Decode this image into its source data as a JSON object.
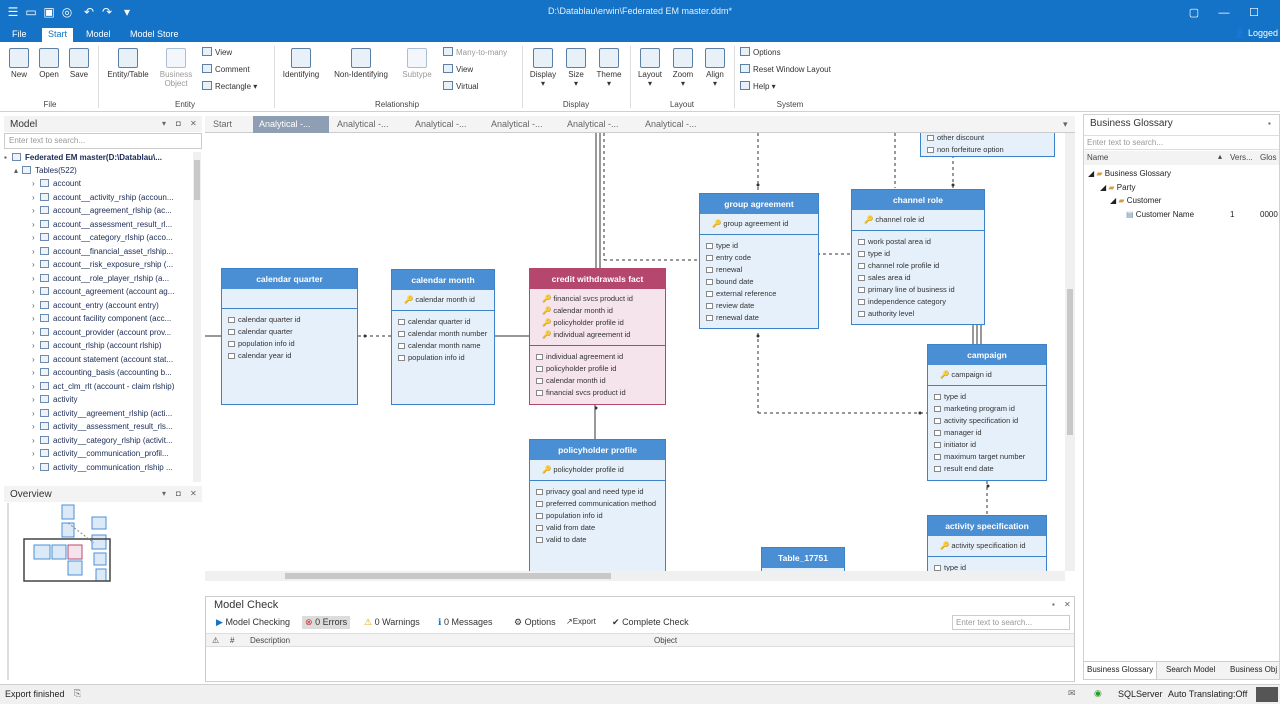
{
  "window": {
    "title": "D:\\Datablau\\erwin\\Federated EM master.ddm*"
  },
  "menu": {
    "items": [
      "File",
      "Start",
      "Model",
      "Model Store"
    ],
    "user": "Logged"
  },
  "ribbon": {
    "large": [
      {
        "label": "New",
        "icon": "new-icon"
      },
      {
        "label": "Open",
        "icon": "open-icon"
      },
      {
        "label": "Save",
        "icon": "save-icon"
      },
      {
        "label": "Entity/Table",
        "icon": "entity-icon"
      },
      {
        "label": "Business\nObject",
        "icon": "business-object-icon"
      },
      {
        "label": "Identifying",
        "icon": "identifying-icon"
      },
      {
        "label": "Non-Identifying",
        "icon": "non-identifying-icon"
      },
      {
        "label": "Subtype",
        "icon": "subtype-icon"
      },
      {
        "label": "Display",
        "icon": "display-icon"
      },
      {
        "label": "Size",
        "icon": "size-icon"
      },
      {
        "label": "Theme",
        "icon": "theme-icon"
      },
      {
        "label": "Layout",
        "icon": "layout-icon"
      },
      {
        "label": "Zoom",
        "icon": "zoom-icon"
      },
      {
        "label": "Align",
        "icon": "align-icon"
      }
    ],
    "small": {
      "view": "View",
      "comment": "Comment",
      "rectangle": "Rectangle",
      "many": "Many-to-many",
      "rview": "View",
      "virtual": "Virtual",
      "options": "Options",
      "reset": "Reset Window Layout",
      "help": "Help"
    },
    "groups": [
      "File",
      "Entity",
      "Relationship",
      "Display",
      "Layout",
      "System"
    ]
  },
  "model": {
    "title": "Model",
    "search_placeholder": "Enter text to search...",
    "root": "Federated EM master(D:\\Datablau\\...",
    "tables": "Tables(522)",
    "items": [
      "account",
      "account__activity_rship (accoun...",
      "account__agreement_rlship (ac...",
      "account__assessment_result_rl...",
      "account__category_rlship (acco...",
      "account__financial_asset_rlship...",
      "account__risk_exposure_rship (...",
      "account__role_player_rlship (a...",
      "account_agreement (account ag...",
      "account_entry (account entry)",
      "account facility component (acc...",
      "account_provider (account prov...",
      "account_rlship (account rlship)",
      "account statement (account stat...",
      "accounting_basis (accounting b...",
      "act_clm_rlt (account - claim rlship)",
      "activity",
      "activity__agreement_rlship (acti...",
      "activity__assessment_result_rls...",
      "activity__category_rlship (activit...",
      "activity__communication_profil...",
      "activity__communication_rlship ..."
    ]
  },
  "overview": {
    "title": "Overview"
  },
  "tabs": [
    "Start",
    "Analytical -...",
    "Analytical -...",
    "Analytical -...",
    "Analytical -...",
    "Analytical -...",
    "Analytical -..."
  ],
  "entities": {
    "calendar_quarter": {
      "title": "calendar quarter",
      "pk": [],
      "attrs": [
        "calendar quarter id",
        "calendar quarter",
        "population info id",
        "calendar year id"
      ]
    },
    "calendar_month": {
      "title": "calendar month",
      "pk": [
        "calendar month id"
      ],
      "attrs": [
        "calendar quarter id",
        "calendar month number",
        "calendar month name",
        "population info id"
      ]
    },
    "credit": {
      "title": "credit withdrawals fact",
      "pk": [
        "financial svcs product id",
        "calendar month id",
        "policyholder profile id",
        "individual agreement id"
      ],
      "attrs": [
        "individual agreement id",
        "policyholder profile id",
        "calendar month id",
        "financial svcs product id"
      ]
    },
    "policyholder": {
      "title": "policyholder profile",
      "pk": [
        "policyholder profile id"
      ],
      "attrs": [
        "privacy goal and need type id",
        "preferred communication method",
        "population info id",
        "valid from date",
        "valid to date"
      ]
    },
    "group_agreement": {
      "title": "group agreement",
      "pk": [
        "group agreement id"
      ],
      "attrs": [
        "type id",
        "entry code",
        "renewal",
        "bound date",
        "external reference",
        "review date",
        "renewal date"
      ]
    },
    "channel_role": {
      "title": "channel role",
      "pk": [
        "channel role id"
      ],
      "attrs": [
        "work postal area id",
        "type id",
        "channel role profile id",
        "sales area id",
        "primary line of business id",
        "independence category",
        "authority level"
      ]
    },
    "campaign": {
      "title": "campaign",
      "pk": [
        "campaign id"
      ],
      "attrs": [
        "type id",
        "marketing program id",
        "activity specification id",
        "manager id",
        "initiator id",
        "maximum target number",
        "result end date"
      ]
    },
    "activity_spec": {
      "title": "activity specification",
      "pk": [
        "activity specification id"
      ],
      "attrs": [
        "type id"
      ]
    },
    "table17751": {
      "title": "Table_17751"
    },
    "partial_top": {
      "attrs": [
        "other discount",
        "non forfeiture option"
      ]
    }
  },
  "model_check": {
    "title": "Model Check",
    "checking": "Model Checking",
    "errors": "0 Errors",
    "warnings": "0 Warnings",
    "messages": "0 Messages",
    "options": "Options",
    "export": "Export",
    "complete": "Complete Check",
    "search_placeholder": "Enter text to search...",
    "col_num": "#",
    "col_desc": "Description",
    "col_obj": "Object"
  },
  "glossary": {
    "title": "Business Glossary",
    "search_placeholder": "Enter text to search...",
    "col_name": "Name",
    "col_vers": "Vers...",
    "col_glos": "Glos",
    "tree": [
      "Business Glossary",
      "Party",
      "Customer",
      "Customer Name"
    ],
    "vers": "1",
    "glos": "0000",
    "tabs": [
      "Business Glossary",
      "Search Model",
      "Business Obj"
    ]
  },
  "status": {
    "left": "Export finished",
    "db": "SQLServer",
    "translate": "Auto Translating:Off"
  }
}
